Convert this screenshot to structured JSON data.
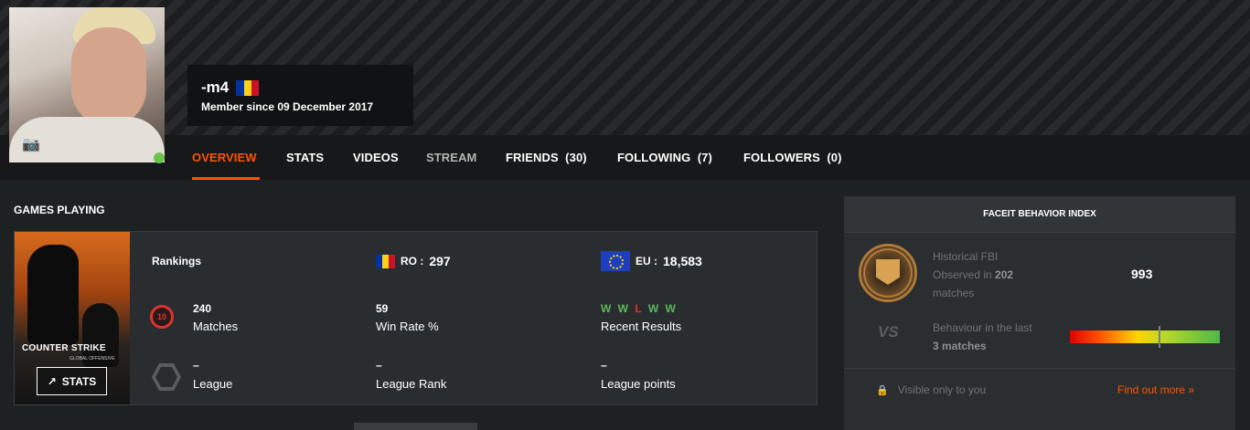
{
  "profile": {
    "nickname": "-m4",
    "country_flag": "romania-flag-icon",
    "member_since": "Member since 09 December 2017",
    "online": true
  },
  "nav": {
    "tabs": [
      {
        "label": "OVERVIEW",
        "active": true
      },
      {
        "label": "STATS"
      },
      {
        "label": "VIDEOS"
      },
      {
        "label": "STREAM"
      },
      {
        "label": "FRIENDS  (30)"
      },
      {
        "label": "FOLLOWING  (7)"
      },
      {
        "label": "FOLLOWERS  (0)"
      }
    ]
  },
  "games": {
    "section_title": "GAMES PLAYING",
    "game": {
      "logo_text": "COUNTER STRIKE",
      "logo_sub": "GLOBAL OFFENSIVE",
      "stats_button": "STATS",
      "rankings_label": "Rankings",
      "ro_label": "RO :",
      "ro_rank": "297",
      "eu_label": "EU :",
      "eu_rank": "18,583",
      "level": "10",
      "matches_value": "240",
      "matches_label": "Matches",
      "winrate_value": "59",
      "winrate_label": "Win Rate %",
      "recent_results": [
        "W",
        "W",
        "L",
        "W",
        "W"
      ],
      "recent_label": "Recent Results",
      "league_value": "–",
      "league_label": "League",
      "league_rank_value": "–",
      "league_rank_label": "League Rank",
      "league_points_value": "–",
      "league_points_label": "League points"
    }
  },
  "fbi": {
    "title": "FACEIT BEHAVIOR INDEX",
    "historical_line1": "Historical FBI",
    "historical_line2_pre": "Observed in ",
    "historical_count": "202",
    "historical_line3": "matches",
    "value": "993",
    "behaviour_line1": "Behaviour in the last",
    "behaviour_line2": "3 matches",
    "behaviour_level": 0.59,
    "visible_note": "Visible only to you",
    "find_more": "Find out more »"
  },
  "colors": {
    "accent": "#ff5500",
    "win": "#5cb85c",
    "loss": "#e0322a"
  }
}
